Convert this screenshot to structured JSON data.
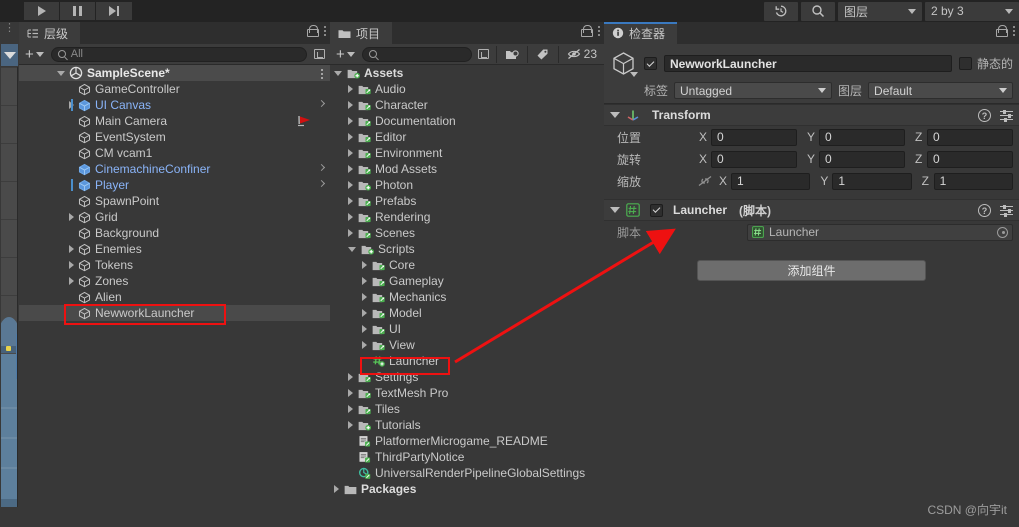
{
  "toolbar": {
    "play_label": "play-icon",
    "pause_label": "pause-icon",
    "step_label": "step-icon",
    "history_icon": "history-icon",
    "search_icon": "search-icon",
    "layers_label": "图层",
    "layout_label": "2 by 3"
  },
  "hierarchy": {
    "tab_label": "层级",
    "search_placeholder": "All",
    "scene_name": "SampleScene*",
    "items": [
      {
        "label": "GameController",
        "depth": 2,
        "expandable": false,
        "prefab": false,
        "chevron": false,
        "marker": false,
        "bar": false
      },
      {
        "label": "UI Canvas",
        "depth": 2,
        "expandable": true,
        "prefab": true,
        "chevron": true,
        "marker": false,
        "bar": true
      },
      {
        "label": "Main Camera",
        "depth": 2,
        "expandable": false,
        "prefab": false,
        "chevron": false,
        "marker": true,
        "bar": false
      },
      {
        "label": "EventSystem",
        "depth": 2,
        "expandable": false,
        "prefab": false,
        "chevron": false,
        "marker": false,
        "bar": false
      },
      {
        "label": "CM vcam1",
        "depth": 2,
        "expandable": false,
        "prefab": false,
        "chevron": false,
        "marker": false,
        "bar": false
      },
      {
        "label": "CinemachineConfiner",
        "depth": 2,
        "expandable": false,
        "prefab": true,
        "chevron": true,
        "marker": false,
        "bar": false
      },
      {
        "label": "Player",
        "depth": 2,
        "expandable": false,
        "prefab": true,
        "chevron": true,
        "marker": false,
        "bar": true
      },
      {
        "label": "SpawnPoint",
        "depth": 2,
        "expandable": false,
        "prefab": false,
        "chevron": false,
        "marker": false,
        "bar": false
      },
      {
        "label": "Grid",
        "depth": 2,
        "expandable": true,
        "prefab": false,
        "chevron": false,
        "marker": false,
        "bar": false
      },
      {
        "label": "Background",
        "depth": 2,
        "expandable": false,
        "prefab": false,
        "chevron": false,
        "marker": false,
        "bar": false
      },
      {
        "label": "Enemies",
        "depth": 2,
        "expandable": true,
        "prefab": false,
        "chevron": false,
        "marker": false,
        "bar": false
      },
      {
        "label": "Tokens",
        "depth": 2,
        "expandable": true,
        "prefab": false,
        "chevron": false,
        "marker": false,
        "bar": false
      },
      {
        "label": "Zones",
        "depth": 2,
        "expandable": true,
        "prefab": false,
        "chevron": false,
        "marker": false,
        "bar": false
      },
      {
        "label": "Alien",
        "depth": 2,
        "expandable": false,
        "prefab": false,
        "chevron": false,
        "marker": false,
        "bar": false
      },
      {
        "label": "NewworkLauncher",
        "depth": 2,
        "expandable": false,
        "prefab": false,
        "chevron": false,
        "marker": false,
        "bar": false,
        "selected": true
      }
    ]
  },
  "project": {
    "tab_label": "项目",
    "search_placeholder": "",
    "badge_count": "23",
    "items": [
      {
        "label": "Assets",
        "depth": 0,
        "expandable": true,
        "open": true,
        "type": "folder-plus",
        "bold": true
      },
      {
        "label": "Audio",
        "depth": 1,
        "expandable": true,
        "open": false,
        "type": "folder-script"
      },
      {
        "label": "Character",
        "depth": 1,
        "expandable": true,
        "open": false,
        "type": "folder-script"
      },
      {
        "label": "Documentation",
        "depth": 1,
        "expandable": true,
        "open": false,
        "type": "folder-script"
      },
      {
        "label": "Editor",
        "depth": 1,
        "expandable": true,
        "open": false,
        "type": "folder-script"
      },
      {
        "label": "Environment",
        "depth": 1,
        "expandable": true,
        "open": false,
        "type": "folder-script"
      },
      {
        "label": "Mod Assets",
        "depth": 1,
        "expandable": true,
        "open": false,
        "type": "folder-script"
      },
      {
        "label": "Photon",
        "depth": 1,
        "expandable": true,
        "open": false,
        "type": "folder-plus"
      },
      {
        "label": "Prefabs",
        "depth": 1,
        "expandable": true,
        "open": false,
        "type": "folder-script"
      },
      {
        "label": "Rendering",
        "depth": 1,
        "expandable": true,
        "open": false,
        "type": "folder-script"
      },
      {
        "label": "Scenes",
        "depth": 1,
        "expandable": true,
        "open": false,
        "type": "folder-script"
      },
      {
        "label": "Scripts",
        "depth": 1,
        "expandable": true,
        "open": true,
        "type": "folder-plus"
      },
      {
        "label": "Core",
        "depth": 2,
        "expandable": true,
        "open": false,
        "type": "folder-script"
      },
      {
        "label": "Gameplay",
        "depth": 2,
        "expandable": true,
        "open": false,
        "type": "folder-script"
      },
      {
        "label": "Mechanics",
        "depth": 2,
        "expandable": true,
        "open": false,
        "type": "folder-script"
      },
      {
        "label": "Model",
        "depth": 2,
        "expandable": true,
        "open": false,
        "type": "folder-script"
      },
      {
        "label": "UI",
        "depth": 2,
        "expandable": true,
        "open": false,
        "type": "folder-script"
      },
      {
        "label": "View",
        "depth": 2,
        "expandable": true,
        "open": false,
        "type": "folder-script"
      },
      {
        "label": "Launcher",
        "depth": 2,
        "expandable": false,
        "open": false,
        "type": "cs-script"
      },
      {
        "label": "Settings",
        "depth": 1,
        "expandable": true,
        "open": false,
        "type": "folder-script"
      },
      {
        "label": "TextMesh Pro",
        "depth": 1,
        "expandable": true,
        "open": false,
        "type": "folder-script"
      },
      {
        "label": "Tiles",
        "depth": 1,
        "expandable": true,
        "open": false,
        "type": "folder-script"
      },
      {
        "label": "Tutorials",
        "depth": 1,
        "expandable": true,
        "open": false,
        "type": "folder-plus"
      },
      {
        "label": "PlatformerMicrogame_README",
        "depth": 1,
        "expandable": false,
        "open": false,
        "type": "doc"
      },
      {
        "label": "ThirdPartyNotice",
        "depth": 1,
        "expandable": false,
        "open": false,
        "type": "doc"
      },
      {
        "label": "UniversalRenderPipelineGlobalSettings",
        "depth": 1,
        "expandable": false,
        "open": false,
        "type": "asset"
      },
      {
        "label": "Packages",
        "depth": 0,
        "expandable": true,
        "open": false,
        "type": "folder-plain",
        "bold": true
      }
    ]
  },
  "inspector": {
    "tab_label": "检查器",
    "object_name": "NewworkLauncher",
    "static_label": "静态的",
    "tag_label": "标签",
    "tag_value": "Untagged",
    "layer_label": "图层",
    "layer_value": "Default",
    "transform": {
      "title": "Transform",
      "rows": [
        {
          "label": "位置",
          "x": "0",
          "y": "0",
          "z": "0",
          "link": false
        },
        {
          "label": "旋转",
          "x": "0",
          "y": "0",
          "z": "0",
          "link": false
        },
        {
          "label": "缩放",
          "x": "1",
          "y": "1",
          "z": "1",
          "link": true
        }
      ],
      "axis_x": "X",
      "axis_y": "Y",
      "axis_z": "Z"
    },
    "component": {
      "title": "Launcher",
      "subtitle": "(脚本)",
      "script_label": "脚本",
      "script_value": "Launcher"
    },
    "add_component_label": "添加组件"
  },
  "watermark": "CSDN @向宇it"
}
